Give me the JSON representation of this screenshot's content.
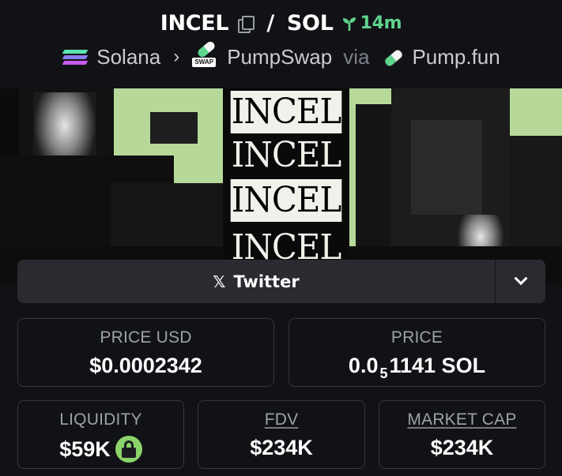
{
  "header": {
    "base_token": "INCEL",
    "separator": "/",
    "quote_token": "SOL",
    "pair_age": "14m"
  },
  "breadcrumb": {
    "chain": "Solana",
    "dex": "PumpSwap",
    "via_label": "via",
    "launchpad": "Pump.fun"
  },
  "banner": {
    "words": [
      "INCEL",
      "INCEL",
      "INCEL",
      "INCEL"
    ]
  },
  "social": {
    "twitter_label": "Twitter"
  },
  "stats": {
    "price_usd_label": "PRICE USD",
    "price_usd_value": "$0.0002342",
    "price_label": "PRICE",
    "price_value_prefix": "0.0",
    "price_value_sub": "5",
    "price_value_suffix": "1141 SOL",
    "liquidity_label": "LIQUIDITY",
    "liquidity_value": "$59K",
    "fdv_label": "FDV",
    "fdv_value": "$234K",
    "mcap_label": "MARKET CAP",
    "mcap_value": "$234K"
  },
  "colors": {
    "accent_green": "#5fd38d",
    "lock_green": "#8bd36a",
    "background": "#111216",
    "banner_green": "#b6d99a"
  },
  "icons": {
    "copy": "copy-icon",
    "age": "seedling-icon",
    "chain": "solana-logo-icon",
    "dex": "pumpswap-icon",
    "launchpad": "pill-icon",
    "twitter": "x-icon",
    "dropdown": "chevron-down-icon",
    "liquidity_lock": "lock-icon"
  }
}
